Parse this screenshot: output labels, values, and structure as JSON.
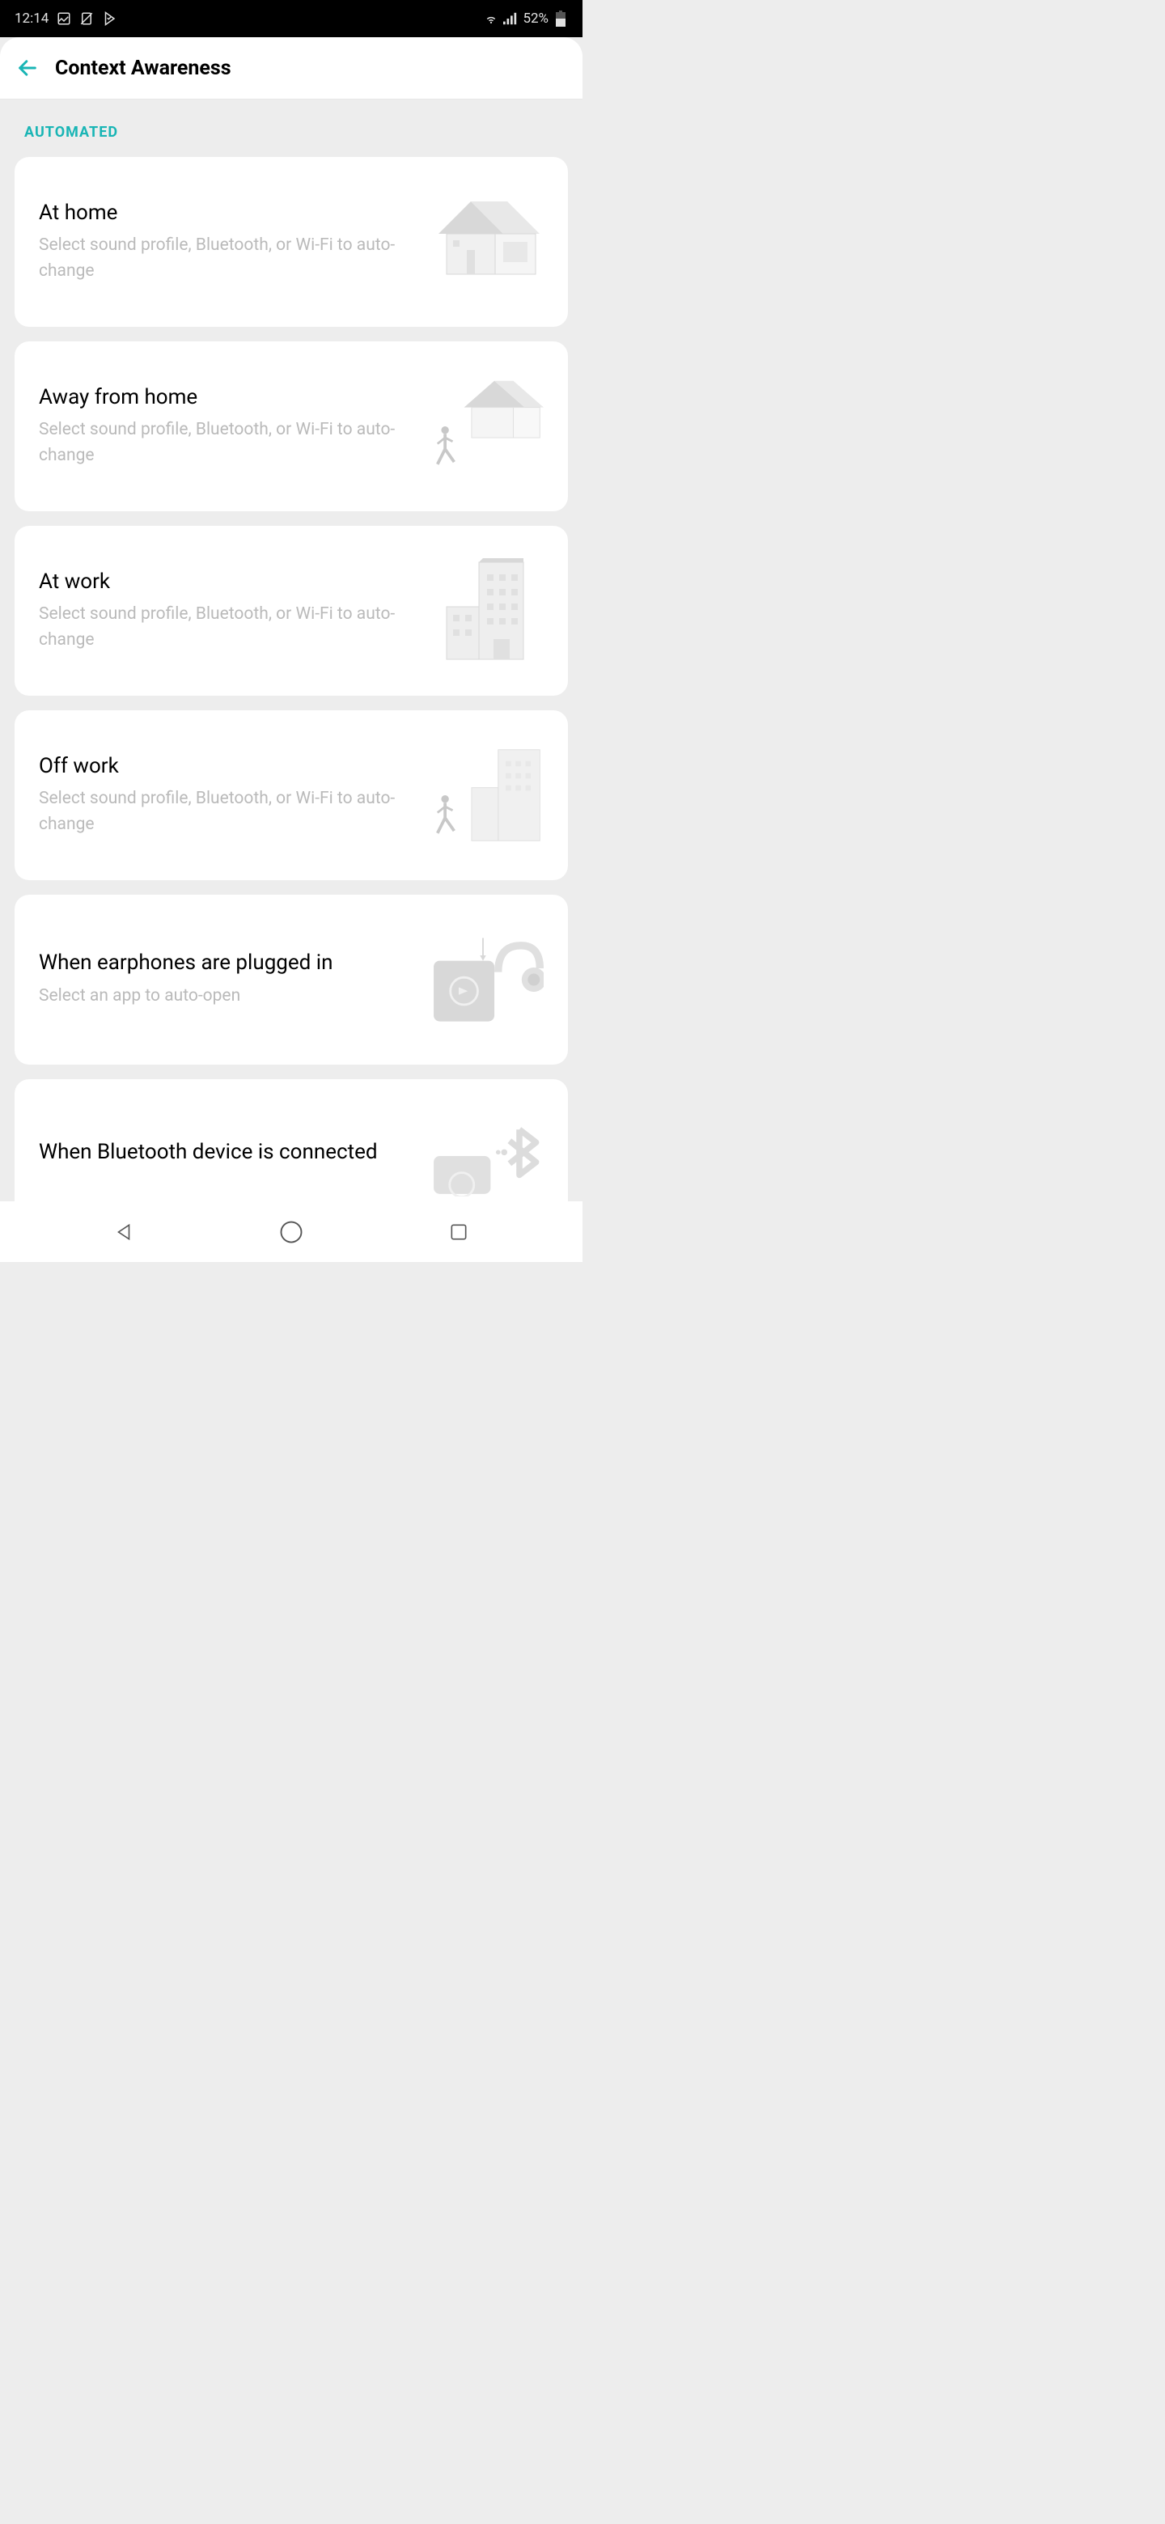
{
  "status_bar": {
    "time": "12:14",
    "battery_percent": "52%"
  },
  "app_bar": {
    "title": "Context Awareness"
  },
  "section_label": "AUTOMATED",
  "cards": [
    {
      "title": "At home",
      "subtitle": "Select sound profile, Bluetooth, or Wi-Fi to auto-change"
    },
    {
      "title": "Away from home",
      "subtitle": "Select sound profile, Bluetooth, or Wi-Fi to auto-change"
    },
    {
      "title": "At work",
      "subtitle": "Select sound profile, Bluetooth, or Wi-Fi to auto-change"
    },
    {
      "title": "Off work",
      "subtitle": "Select sound profile, Bluetooth, or Wi-Fi to auto-change"
    },
    {
      "title": "When earphones are plugged in",
      "subtitle": "Select an app to auto-open"
    },
    {
      "title": "When Bluetooth device is connected",
      "subtitle": ""
    }
  ]
}
